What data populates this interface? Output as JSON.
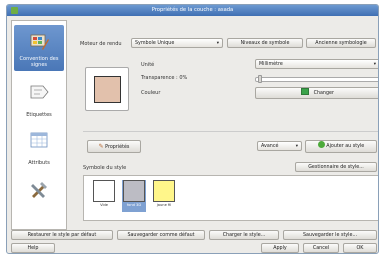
{
  "window": {
    "title": "Propriétés de la couche : asada"
  },
  "sidebar": {
    "items": [
      {
        "label": "Convention des signes",
        "icon": "brush-palette-icon",
        "active": true
      },
      {
        "label": "Etiquettes",
        "icon": "label-icon",
        "active": false
      },
      {
        "label": "Attributs",
        "icon": "table-icon",
        "active": false
      },
      {
        "label": "",
        "icon": "tools-icon",
        "active": false
      }
    ]
  },
  "renderer": {
    "label": "Moteur de rendu",
    "value": "Symbole Unique",
    "symbol_levels": "Niveaux de symbole",
    "old_symbology": "Ancienne symbologie"
  },
  "props": {
    "unit_label": "Unité",
    "unit_value": "Millimètre",
    "transparency": "Transparence : 0%",
    "color_label": "Couleur",
    "change_label": "Changer",
    "change_color": "#3aa34a",
    "fill_color": "#e2c1ac"
  },
  "actions": {
    "properties": "Propriétés",
    "advanced": "Avancé",
    "add_style": "Ajouter au style"
  },
  "style": {
    "title": "Symbole du style",
    "manager": "Gestionnaire de style...",
    "symbols": [
      {
        "name": "Vide",
        "color": "#ffffff",
        "selected": false
      },
      {
        "name": "fond 3D",
        "color": "#bcbcc4",
        "selected": true
      },
      {
        "name": "jaune fil",
        "color": "#fff68a",
        "selected": false
      }
    ]
  },
  "bottom": {
    "restore": "Restaurer le style par défaut",
    "save_default": "Sauvegarder comme défaut",
    "load_style": "Charger le style...",
    "save_style": "Sauvegarder le style..."
  },
  "footer": {
    "help": "Help",
    "apply": "Apply",
    "cancel": "Cancel",
    "ok": "OK"
  }
}
